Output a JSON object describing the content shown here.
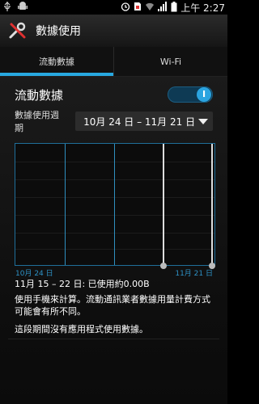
{
  "status_bar": {
    "time": "上午 2:27",
    "icons": [
      "usb-icon",
      "android-icon",
      "alarm-icon",
      "sim-icon",
      "wifi-icon",
      "signal-icon",
      "battery-icon"
    ]
  },
  "action_bar": {
    "title": "數據使用",
    "icon": "tools-icon"
  },
  "tabs": [
    {
      "label": "流動數據",
      "active": true
    },
    {
      "label": "Wi-Fi",
      "active": false
    }
  ],
  "mobile_data": {
    "label": "流動數據",
    "toggle_state": "I"
  },
  "cycle": {
    "label": "數據使用週期",
    "value": "10月 24 日 – 11月 21 日"
  },
  "chart": {
    "start_label": "10月 24 日",
    "end_label": "11月 21 日"
  },
  "summary": "11月 15 – 22 日: 已使用約0.00B",
  "info_text": "使用手機來計算。流動通訊業者數據用量計費方式可能會有所不同。",
  "no_data_text": "這段期間沒有應用程式使用數據。",
  "colors": {
    "accent": "#28a9e1",
    "background": "#000000"
  }
}
